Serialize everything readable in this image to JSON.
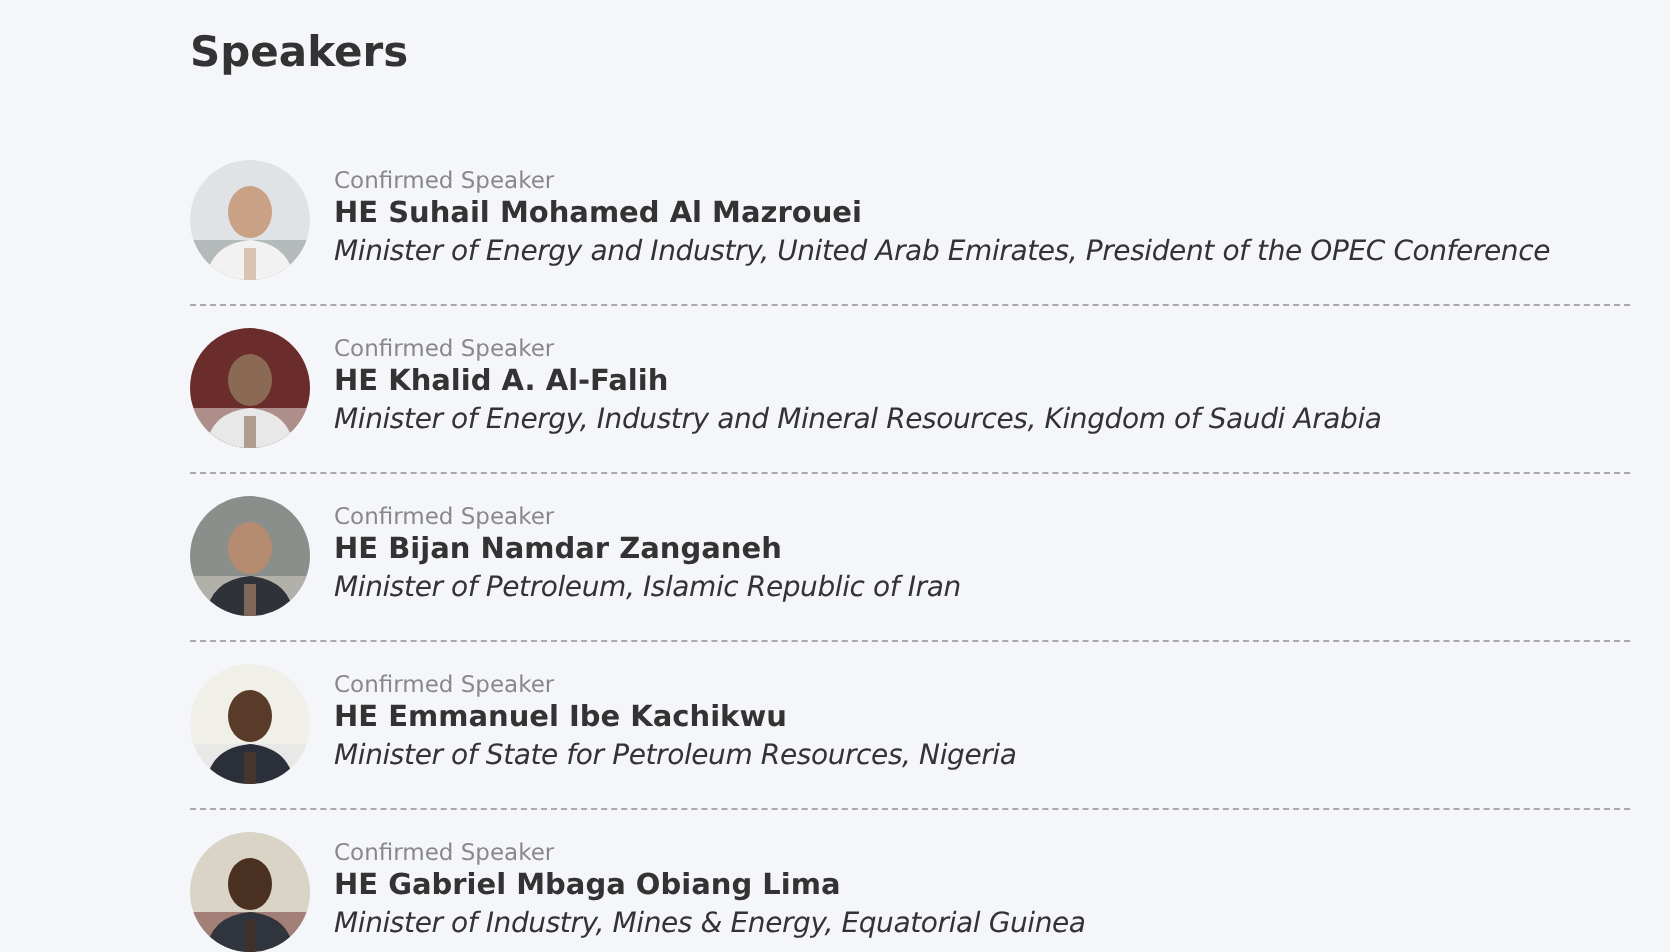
{
  "heading": "Speakers",
  "speakers": [
    {
      "status": "Confirmed Speaker",
      "name": "HE Suhail Mohamed Al Mazrouei",
      "title": "Minister of Energy and Industry, United Arab Emirates, President of the OPEC Conference"
    },
    {
      "status": "Confirmed Speaker",
      "name": "HE Khalid A. Al-Falih",
      "title": "Minister of Energy, Industry and Mineral Resources, Kingdom of Saudi Arabia"
    },
    {
      "status": "Confirmed Speaker",
      "name": "HE Bijan Namdar Zanganeh",
      "title": "Minister of Petroleum, Islamic Republic of Iran"
    },
    {
      "status": "Confirmed Speaker",
      "name": "HE Emmanuel Ibe Kachikwu",
      "title": "Minister of State for Petroleum Resources, Nigeria"
    },
    {
      "status": "Confirmed Speaker",
      "name": "HE Gabriel Mbaga Obiang Lima",
      "title": "Minister of Industry, Mines & Energy, Equatorial Guinea"
    }
  ]
}
